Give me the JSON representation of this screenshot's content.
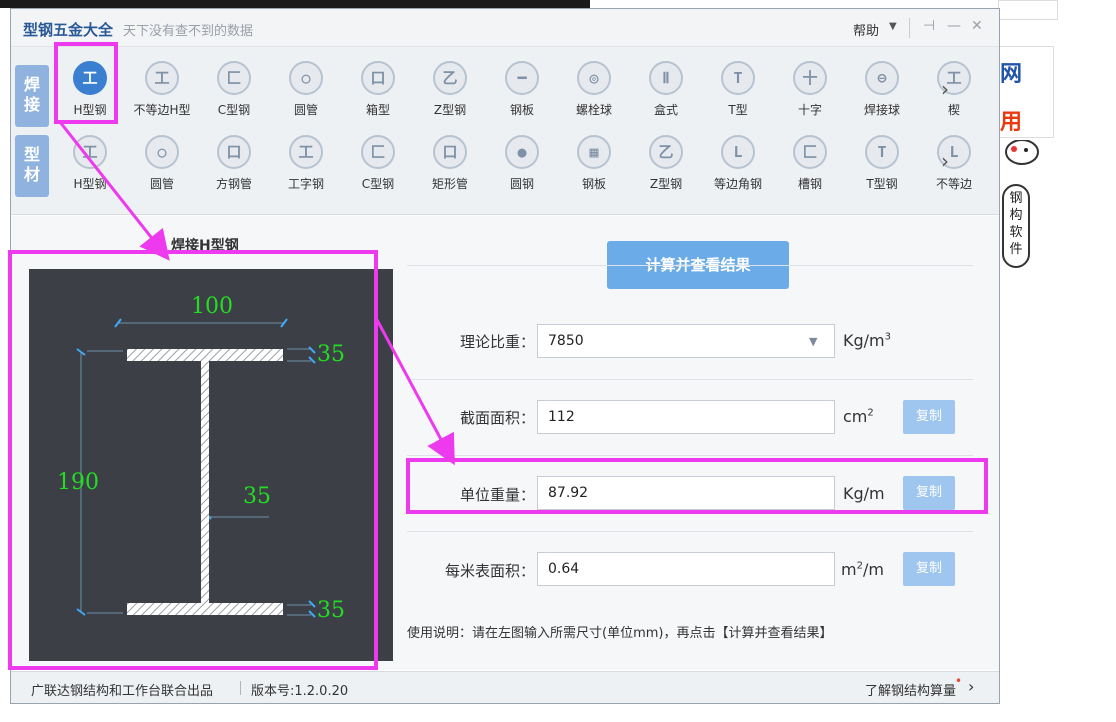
{
  "window": {
    "title": "型钢五金大全",
    "subtitle": "天下没有查不到的数据",
    "help_label": "帮助",
    "help_arrow": "▼",
    "pin_icon": "⊣",
    "min_icon": "—",
    "close_icon": "✕"
  },
  "side_tabs": [
    {
      "label": "焊\n接"
    },
    {
      "label": "型\n材"
    }
  ],
  "welded_tools": [
    {
      "icon": "工",
      "label": "H型钢",
      "active": true
    },
    {
      "icon": "工",
      "label": "不等边H型"
    },
    {
      "icon": "匚",
      "label": "C型钢"
    },
    {
      "icon": "○",
      "label": "圆管"
    },
    {
      "icon": "口",
      "label": "箱型"
    },
    {
      "icon": "乙",
      "label": "Z型钢"
    },
    {
      "icon": "━",
      "label": "钢板"
    },
    {
      "icon": "◎",
      "label": "螺栓球"
    },
    {
      "icon": "Ⅱ",
      "label": "盒式"
    },
    {
      "icon": "T",
      "label": "T型"
    },
    {
      "icon": "十",
      "label": "十字"
    },
    {
      "icon": "⊖",
      "label": "焊接球"
    },
    {
      "icon": "工",
      "label": "楔"
    }
  ],
  "profile_tools": [
    {
      "icon": "工",
      "label": "H型钢"
    },
    {
      "icon": "○",
      "label": "圆管"
    },
    {
      "icon": "口",
      "label": "方钢管"
    },
    {
      "icon": "工",
      "label": "工字钢"
    },
    {
      "icon": "匚",
      "label": "C型钢"
    },
    {
      "icon": "口",
      "label": "矩形管"
    },
    {
      "icon": "●",
      "label": "圆钢"
    },
    {
      "icon": "▦",
      "label": "钢板"
    },
    {
      "icon": "乙",
      "label": "Z型钢"
    },
    {
      "icon": "L",
      "label": "等边角钢"
    },
    {
      "icon": "匚",
      "label": "槽钢"
    },
    {
      "icon": "T",
      "label": "T型钢"
    },
    {
      "icon": "L",
      "label": "不等边"
    }
  ],
  "next_arrow": "›",
  "diagram": {
    "title": "焊接H型钢",
    "width": "100",
    "height": "190",
    "web": "35",
    "top_flange": "35",
    "bottom_flange": "35"
  },
  "calc_button": "计算并查看结果",
  "rows": {
    "density": {
      "label": "理论比重：",
      "value": "7850",
      "unit": "Kg/m",
      "unit_sup": "3"
    },
    "area": {
      "label": "截面面积：",
      "value": "112",
      "unit": "cm",
      "unit_sup": "2",
      "copy": "复制"
    },
    "weight": {
      "label": "单位重量：",
      "value": "87.92",
      "unit": "Kg/m",
      "copy": "复制"
    },
    "surface": {
      "label": "每米表面积：",
      "value": "0.64",
      "unit": "m",
      "unit_sup": "2",
      "unit_tail": "/m",
      "copy": "复制"
    }
  },
  "hint": "使用说明：请在左图输入所需尺寸(单位mm)，再点击【计算并查看结果】",
  "status": {
    "publisher": "广联达钢结构和工作台联合出品",
    "version": "版本号:1.2.0.20",
    "link": "了解钢结构算量",
    "dot": "•",
    "arrow": "›"
  },
  "background": {
    "ad_text1": "网",
    "ad_text2": "用",
    "mascot_text": "钢\n构\n软\n件"
  },
  "colors": {
    "accent": "#3a7fd0",
    "button": "#6aabe8",
    "highlight": "#ee3aee",
    "dimension_text": "#22dd22",
    "dimension_tick": "#3fa9f5"
  }
}
